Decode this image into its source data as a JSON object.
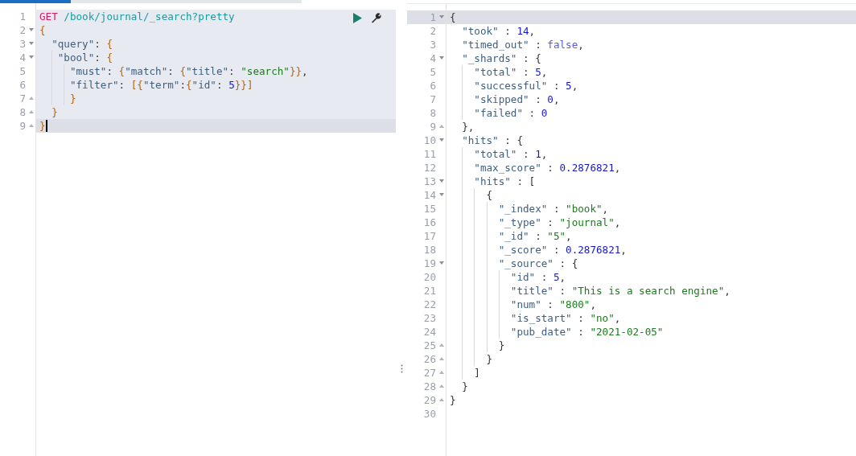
{
  "request_editor": {
    "lines": [
      {
        "number": "1",
        "highlighted": true,
        "current": false,
        "fold_start": false,
        "fold_end": false,
        "tokens": [
          {
            "t": "GET",
            "kind": "method"
          },
          {
            "t": " /book/journal/_search?pretty",
            "kind": "url"
          }
        ]
      },
      {
        "number": "2",
        "highlighted": true,
        "current": false,
        "fold_start": true,
        "fold_end": false,
        "tokens": [
          {
            "t": "{",
            "kind": "brace"
          }
        ]
      },
      {
        "number": "3",
        "highlighted": true,
        "current": false,
        "fold_start": true,
        "fold_end": false,
        "tokens": [
          {
            "t": "  \"query\"",
            "kind": "key"
          },
          {
            "t": ": ",
            "kind": "punct"
          },
          {
            "t": "{",
            "kind": "brace"
          }
        ]
      },
      {
        "number": "4",
        "highlighted": true,
        "current": false,
        "fold_start": true,
        "fold_end": false,
        "tokens": [
          {
            "t": "   \"bool\"",
            "kind": "key"
          },
          {
            "t": ": ",
            "kind": "punct"
          },
          {
            "t": "{",
            "kind": "brace"
          }
        ]
      },
      {
        "number": "5",
        "highlighted": true,
        "current": false,
        "fold_start": false,
        "fold_end": false,
        "tokens": [
          {
            "t": "     \"must\"",
            "kind": "key"
          },
          {
            "t": ": ",
            "kind": "punct"
          },
          {
            "t": "{",
            "kind": "brace"
          },
          {
            "t": "\"match\"",
            "kind": "key"
          },
          {
            "t": ": ",
            "kind": "punct"
          },
          {
            "t": "{",
            "kind": "brace"
          },
          {
            "t": "\"title\"",
            "kind": "key"
          },
          {
            "t": ": ",
            "kind": "punct"
          },
          {
            "t": "\"search\"",
            "kind": "string"
          },
          {
            "t": "}}",
            "kind": "brace"
          },
          {
            "t": ",",
            "kind": "punct"
          }
        ]
      },
      {
        "number": "6",
        "highlighted": true,
        "current": false,
        "fold_start": false,
        "fold_end": false,
        "tokens": [
          {
            "t": "     \"filter\"",
            "kind": "key"
          },
          {
            "t": ": ",
            "kind": "punct"
          },
          {
            "t": "[{",
            "kind": "brace"
          },
          {
            "t": "\"term\"",
            "kind": "key"
          },
          {
            "t": ":",
            "kind": "punct"
          },
          {
            "t": "{",
            "kind": "brace"
          },
          {
            "t": "\"id\"",
            "kind": "key"
          },
          {
            "t": ": ",
            "kind": "punct"
          },
          {
            "t": "5",
            "kind": "number"
          },
          {
            "t": "}}]",
            "kind": "brace"
          }
        ]
      },
      {
        "number": "7",
        "highlighted": true,
        "current": false,
        "fold_start": false,
        "fold_end": true,
        "tokens": [
          {
            "t": "     }",
            "kind": "brace"
          }
        ]
      },
      {
        "number": "8",
        "highlighted": true,
        "current": false,
        "fold_start": false,
        "fold_end": true,
        "tokens": [
          {
            "t": "  }",
            "kind": "brace"
          }
        ]
      },
      {
        "number": "9",
        "highlighted": false,
        "current": true,
        "fold_start": false,
        "fold_end": true,
        "cursor": true,
        "tokens": [
          {
            "t": "}",
            "kind": "brace"
          }
        ]
      }
    ]
  },
  "response_viewer": {
    "lines": [
      {
        "number": "1",
        "current": true,
        "fold_start": true,
        "fold_end": false,
        "tokens": [
          {
            "t": "{",
            "kind": "punct"
          }
        ]
      },
      {
        "number": "2",
        "current": false,
        "fold_start": false,
        "fold_end": false,
        "tokens": [
          {
            "t": "  \"took\"",
            "kind": "key"
          },
          {
            "t": " : ",
            "kind": "punct"
          },
          {
            "t": "14",
            "kind": "number"
          },
          {
            "t": ",",
            "kind": "punct"
          }
        ]
      },
      {
        "number": "3",
        "current": false,
        "fold_start": false,
        "fold_end": false,
        "tokens": [
          {
            "t": "  \"timed_out\"",
            "kind": "key"
          },
          {
            "t": " : ",
            "kind": "punct"
          },
          {
            "t": "false",
            "kind": "bool"
          },
          {
            "t": ",",
            "kind": "punct"
          }
        ]
      },
      {
        "number": "4",
        "current": false,
        "fold_start": true,
        "fold_end": false,
        "tokens": [
          {
            "t": "  \"_shards\"",
            "kind": "key"
          },
          {
            "t": " : ",
            "kind": "punct"
          },
          {
            "t": "{",
            "kind": "punct"
          }
        ]
      },
      {
        "number": "5",
        "current": false,
        "fold_start": false,
        "fold_end": false,
        "tokens": [
          {
            "t": "    \"total\"",
            "kind": "key"
          },
          {
            "t": " : ",
            "kind": "punct"
          },
          {
            "t": "5",
            "kind": "number"
          },
          {
            "t": ",",
            "kind": "punct"
          }
        ]
      },
      {
        "number": "6",
        "current": false,
        "fold_start": false,
        "fold_end": false,
        "tokens": [
          {
            "t": "    \"successful\"",
            "kind": "key"
          },
          {
            "t": " : ",
            "kind": "punct"
          },
          {
            "t": "5",
            "kind": "number"
          },
          {
            "t": ",",
            "kind": "punct"
          }
        ]
      },
      {
        "number": "7",
        "current": false,
        "fold_start": false,
        "fold_end": false,
        "tokens": [
          {
            "t": "    \"skipped\"",
            "kind": "key"
          },
          {
            "t": " : ",
            "kind": "punct"
          },
          {
            "t": "0",
            "kind": "number"
          },
          {
            "t": ",",
            "kind": "punct"
          }
        ]
      },
      {
        "number": "8",
        "current": false,
        "fold_start": false,
        "fold_end": false,
        "tokens": [
          {
            "t": "    \"failed\"",
            "kind": "key"
          },
          {
            "t": " : ",
            "kind": "punct"
          },
          {
            "t": "0",
            "kind": "number"
          }
        ]
      },
      {
        "number": "9",
        "current": false,
        "fold_start": false,
        "fold_end": true,
        "tokens": [
          {
            "t": "  },",
            "kind": "punct"
          }
        ]
      },
      {
        "number": "10",
        "current": false,
        "fold_start": true,
        "fold_end": false,
        "tokens": [
          {
            "t": "  \"hits\"",
            "kind": "key"
          },
          {
            "t": " : ",
            "kind": "punct"
          },
          {
            "t": "{",
            "kind": "punct"
          }
        ]
      },
      {
        "number": "11",
        "current": false,
        "fold_start": false,
        "fold_end": false,
        "tokens": [
          {
            "t": "    \"total\"",
            "kind": "key"
          },
          {
            "t": " : ",
            "kind": "punct"
          },
          {
            "t": "1",
            "kind": "number"
          },
          {
            "t": ",",
            "kind": "punct"
          }
        ]
      },
      {
        "number": "12",
        "current": false,
        "fold_start": false,
        "fold_end": false,
        "tokens": [
          {
            "t": "    \"max_score\"",
            "kind": "key"
          },
          {
            "t": " : ",
            "kind": "punct"
          },
          {
            "t": "0.2876821",
            "kind": "number"
          },
          {
            "t": ",",
            "kind": "punct"
          }
        ]
      },
      {
        "number": "13",
        "current": false,
        "fold_start": true,
        "fold_end": false,
        "tokens": [
          {
            "t": "    \"hits\"",
            "kind": "key"
          },
          {
            "t": " : ",
            "kind": "punct"
          },
          {
            "t": "[",
            "kind": "punct"
          }
        ]
      },
      {
        "number": "14",
        "current": false,
        "fold_start": true,
        "fold_end": false,
        "tokens": [
          {
            "t": "      {",
            "kind": "punct"
          }
        ]
      },
      {
        "number": "15",
        "current": false,
        "fold_start": false,
        "fold_end": false,
        "tokens": [
          {
            "t": "        \"_index\"",
            "kind": "key"
          },
          {
            "t": " : ",
            "kind": "punct"
          },
          {
            "t": "\"book\"",
            "kind": "string"
          },
          {
            "t": ",",
            "kind": "punct"
          }
        ]
      },
      {
        "number": "16",
        "current": false,
        "fold_start": false,
        "fold_end": false,
        "tokens": [
          {
            "t": "        \"_type\"",
            "kind": "key"
          },
          {
            "t": " : ",
            "kind": "punct"
          },
          {
            "t": "\"journal\"",
            "kind": "string"
          },
          {
            "t": ",",
            "kind": "punct"
          }
        ]
      },
      {
        "number": "17",
        "current": false,
        "fold_start": false,
        "fold_end": false,
        "tokens": [
          {
            "t": "        \"_id\"",
            "kind": "key"
          },
          {
            "t": " : ",
            "kind": "punct"
          },
          {
            "t": "\"5\"",
            "kind": "string"
          },
          {
            "t": ",",
            "kind": "punct"
          }
        ]
      },
      {
        "number": "18",
        "current": false,
        "fold_start": false,
        "fold_end": false,
        "tokens": [
          {
            "t": "        \"_score\"",
            "kind": "key"
          },
          {
            "t": " : ",
            "kind": "punct"
          },
          {
            "t": "0.2876821",
            "kind": "number"
          },
          {
            "t": ",",
            "kind": "punct"
          }
        ]
      },
      {
        "number": "19",
        "current": false,
        "fold_start": true,
        "fold_end": false,
        "tokens": [
          {
            "t": "        \"_source\"",
            "kind": "key"
          },
          {
            "t": " : ",
            "kind": "punct"
          },
          {
            "t": "{",
            "kind": "punct"
          }
        ]
      },
      {
        "number": "20",
        "current": false,
        "fold_start": false,
        "fold_end": false,
        "tokens": [
          {
            "t": "          \"id\"",
            "kind": "key"
          },
          {
            "t": " : ",
            "kind": "punct"
          },
          {
            "t": "5",
            "kind": "number"
          },
          {
            "t": ",",
            "kind": "punct"
          }
        ]
      },
      {
        "number": "21",
        "current": false,
        "fold_start": false,
        "fold_end": false,
        "tokens": [
          {
            "t": "          \"title\"",
            "kind": "key"
          },
          {
            "t": " : ",
            "kind": "punct"
          },
          {
            "t": "\"This is a search engine\"",
            "kind": "string"
          },
          {
            "t": ",",
            "kind": "punct"
          }
        ]
      },
      {
        "number": "22",
        "current": false,
        "fold_start": false,
        "fold_end": false,
        "tokens": [
          {
            "t": "          \"num\"",
            "kind": "key"
          },
          {
            "t": " : ",
            "kind": "punct"
          },
          {
            "t": "\"800\"",
            "kind": "string"
          },
          {
            "t": ",",
            "kind": "punct"
          }
        ]
      },
      {
        "number": "23",
        "current": false,
        "fold_start": false,
        "fold_end": false,
        "tokens": [
          {
            "t": "          \"is_start\"",
            "kind": "key"
          },
          {
            "t": " : ",
            "kind": "punct"
          },
          {
            "t": "\"no\"",
            "kind": "string"
          },
          {
            "t": ",",
            "kind": "punct"
          }
        ]
      },
      {
        "number": "24",
        "current": false,
        "fold_start": false,
        "fold_end": false,
        "tokens": [
          {
            "t": "          \"pub_date\"",
            "kind": "key"
          },
          {
            "t": " : ",
            "kind": "punct"
          },
          {
            "t": "\"2021-02-05\"",
            "kind": "string"
          }
        ]
      },
      {
        "number": "25",
        "current": false,
        "fold_start": false,
        "fold_end": true,
        "tokens": [
          {
            "t": "        }",
            "kind": "punct"
          }
        ]
      },
      {
        "number": "26",
        "current": false,
        "fold_start": false,
        "fold_end": true,
        "tokens": [
          {
            "t": "      }",
            "kind": "punct"
          }
        ]
      },
      {
        "number": "27",
        "current": false,
        "fold_start": false,
        "fold_end": true,
        "tokens": [
          {
            "t": "    ]",
            "kind": "punct"
          }
        ]
      },
      {
        "number": "28",
        "current": false,
        "fold_start": false,
        "fold_end": true,
        "tokens": [
          {
            "t": "  }",
            "kind": "punct"
          }
        ]
      },
      {
        "number": "29",
        "current": false,
        "fold_start": false,
        "fold_end": true,
        "tokens": [
          {
            "t": "}",
            "kind": "punct"
          }
        ]
      },
      {
        "number": "30",
        "current": false,
        "fold_start": false,
        "fold_end": false
      }
    ]
  }
}
